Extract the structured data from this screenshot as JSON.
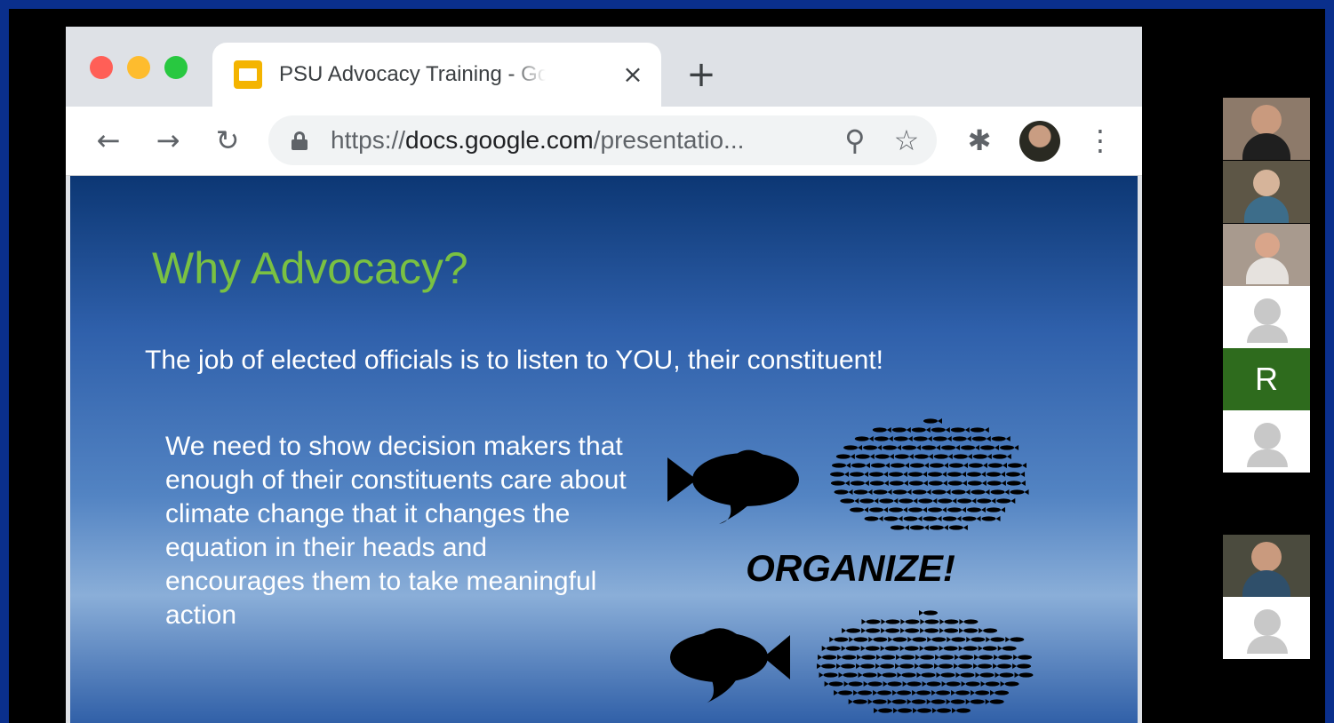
{
  "browser": {
    "tab": {
      "title": "PSU Advocacy Training - Google Slides",
      "close_symbol": "×"
    },
    "new_tab_symbol": "+",
    "toolbar": {
      "back_symbol": "←",
      "forward_symbol": "→",
      "reload_symbol": "↻",
      "url_scheme": "https://",
      "url_host": "docs.google.com",
      "url_path": "/presentatio...",
      "zoom_symbol": "⚲",
      "star_symbol": "☆",
      "extensions_symbol": "✱",
      "menu_symbol": "⋮"
    }
  },
  "slide": {
    "title": "Why Advocacy?",
    "subtitle": "The job of elected officials is to listen to YOU, their constituent!",
    "body": "We need to show decision makers that enough of their constituents care about climate change that it changes the equation in their heads and encourages them to take meaningful action",
    "image_caption": "ORGANIZE!",
    "colors": {
      "title": "#7ac142",
      "text": "#ffffff"
    }
  },
  "participants": [
    {
      "kind": "video",
      "icon": "participant-video-1"
    },
    {
      "kind": "video",
      "icon": "participant-video-2"
    },
    {
      "kind": "video",
      "icon": "participant-video-3"
    },
    {
      "kind": "placeholder",
      "icon": "person-placeholder-icon"
    },
    {
      "kind": "initial",
      "initial": "R",
      "color": "#2e6b1d"
    },
    {
      "kind": "placeholder",
      "icon": "person-placeholder-icon"
    },
    {
      "kind": "video",
      "icon": "participant-video-4"
    },
    {
      "kind": "placeholder",
      "icon": "person-placeholder-icon"
    }
  ]
}
